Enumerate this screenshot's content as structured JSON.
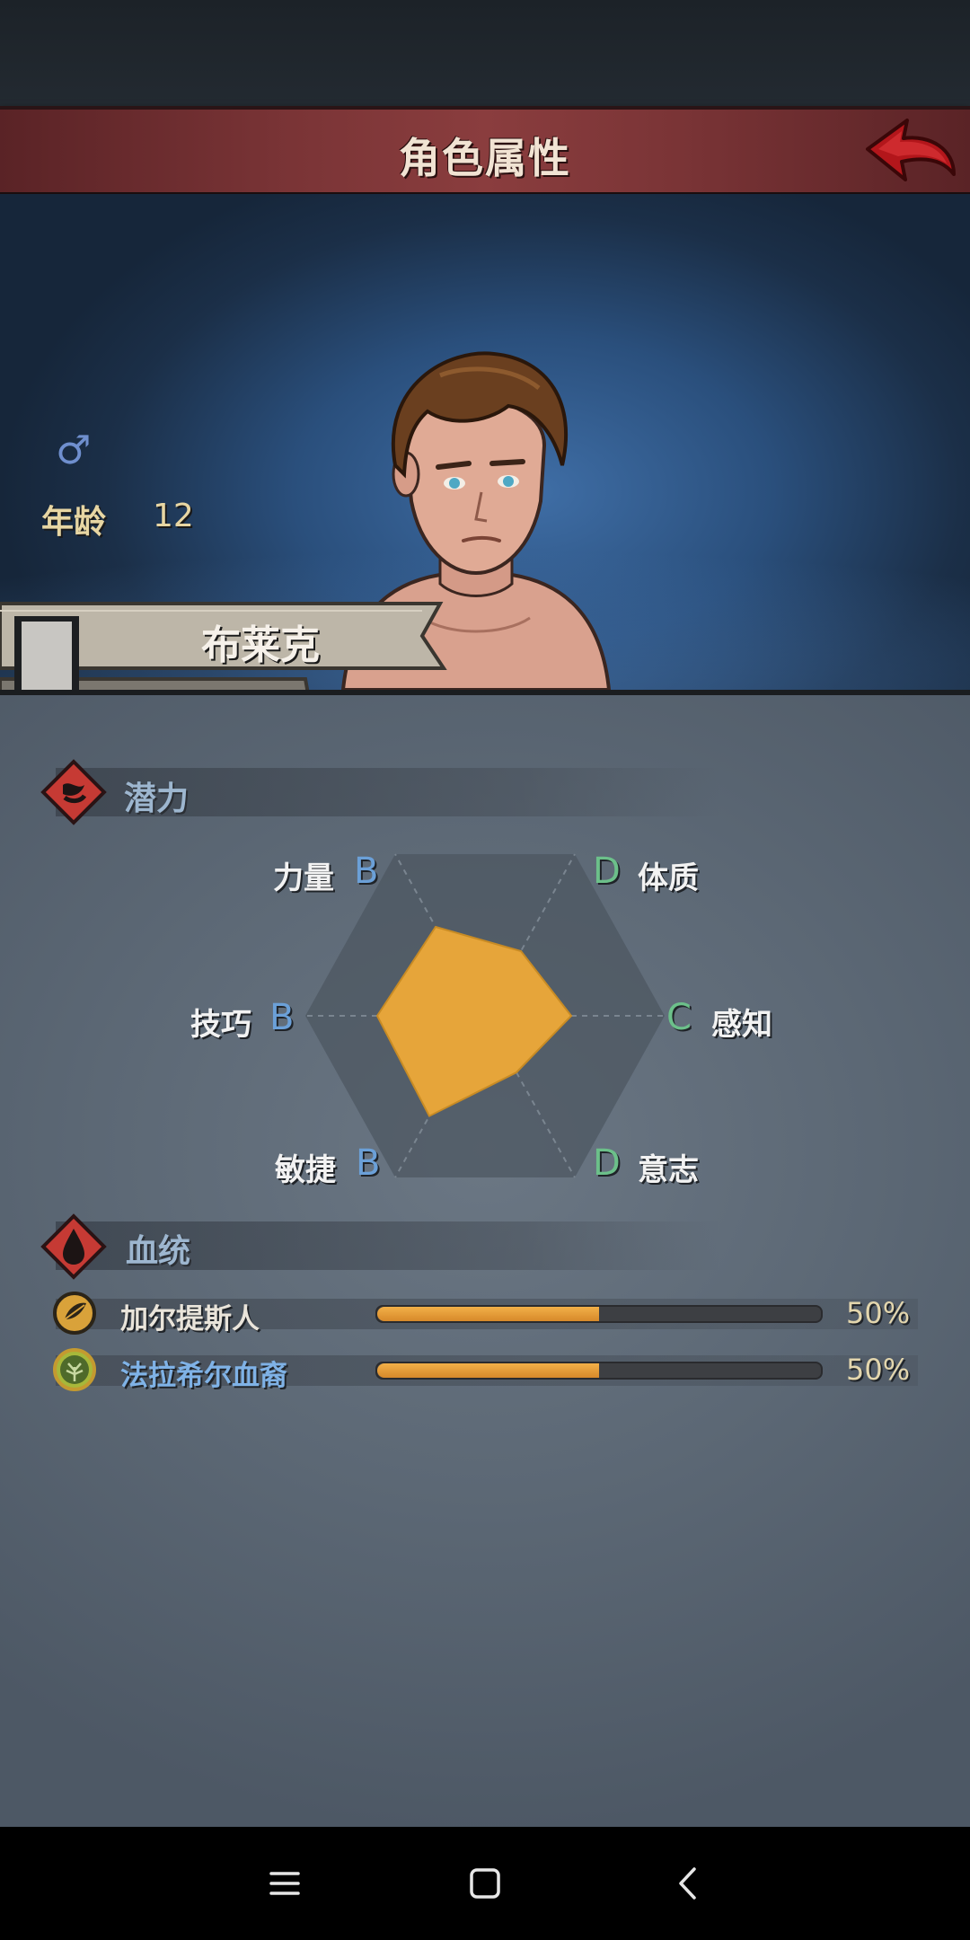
{
  "header": {
    "title": "角色属性",
    "back_icon": "red-back-arrow-icon"
  },
  "character": {
    "gender_symbol": "♂",
    "age_label": "年龄",
    "age_value": "12",
    "name": "布莱克"
  },
  "potential": {
    "title": "潜力",
    "stats": [
      {
        "name": "力量",
        "grade": "B"
      },
      {
        "name": "体质",
        "grade": "D"
      },
      {
        "name": "感知",
        "grade": "C"
      },
      {
        "name": "意志",
        "grade": "D"
      },
      {
        "name": "敏捷",
        "grade": "B"
      },
      {
        "name": "技巧",
        "grade": "B"
      }
    ]
  },
  "chart_data": {
    "type": "radar",
    "categories": [
      "力量",
      "体质",
      "感知",
      "意志",
      "敏捷",
      "技巧"
    ],
    "grades": [
      "B",
      "D",
      "C",
      "D",
      "B",
      "B"
    ],
    "values": [
      0.55,
      0.4,
      0.48,
      0.35,
      0.62,
      0.6
    ],
    "max": 1
  },
  "bloodline": {
    "title": "血统",
    "items": [
      {
        "name": "加尔提斯人",
        "percent_text": "50%",
        "percent": 50,
        "name_color": "#e9e4da"
      },
      {
        "name": "法拉希尔血裔",
        "percent_text": "50%",
        "percent": 50,
        "name_color": "#7fb2e6"
      }
    ]
  },
  "colors": {
    "accent": "#e6a53a",
    "banner": "#7a3436",
    "panel": "#5c6875"
  },
  "nav": {
    "menu_icon": "menu-icon",
    "home_icon": "home-icon",
    "back_icon": "back-icon"
  }
}
